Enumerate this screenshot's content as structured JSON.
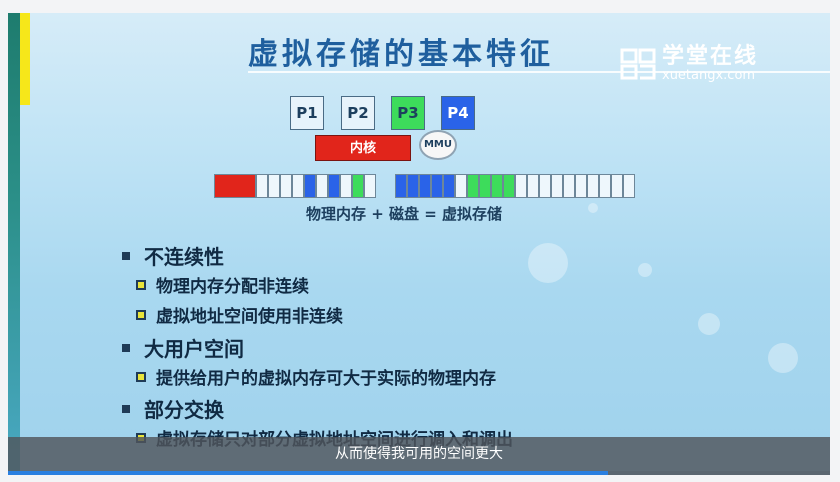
{
  "slide": {
    "title": "虚拟存储的基本特征",
    "brand_cn": "学堂在线",
    "brand_en": "xuetangx.com",
    "processes": [
      {
        "label": "P1",
        "color": "#e7f3fb"
      },
      {
        "label": "P2",
        "color": "#e7f3fb"
      },
      {
        "label": "P3",
        "color": "#3ddc5b"
      },
      {
        "label": "P4",
        "color": "#2a63e8"
      }
    ],
    "kernel_label": "内核",
    "mmu_label": "MMU",
    "memory_caption": "物理内存 + 磁盘 = 虚拟存储",
    "bullets": [
      {
        "level": 1,
        "text": "不连续性"
      },
      {
        "level": 2,
        "text": "物理内存分配非连续"
      },
      {
        "level": 2,
        "text": "虚拟地址空间使用非连续"
      },
      {
        "level": 1,
        "text": "大用户空间"
      },
      {
        "level": 2,
        "text": "提供给用户的虚拟内存可大于实际的物理内存"
      },
      {
        "level": 1,
        "text": "部分交换"
      },
      {
        "level": 2,
        "text": "虚拟存储只对部分虚拟地址空间进行调入和调出"
      }
    ]
  },
  "player": {
    "subtitle": "从而使得我可用的空间更大",
    "progress_fraction": 0.73
  },
  "colors": {
    "red": "#e1251b",
    "green": "#3ddc5b",
    "blue": "#2a63e8",
    "empty": "#eef7fc"
  }
}
